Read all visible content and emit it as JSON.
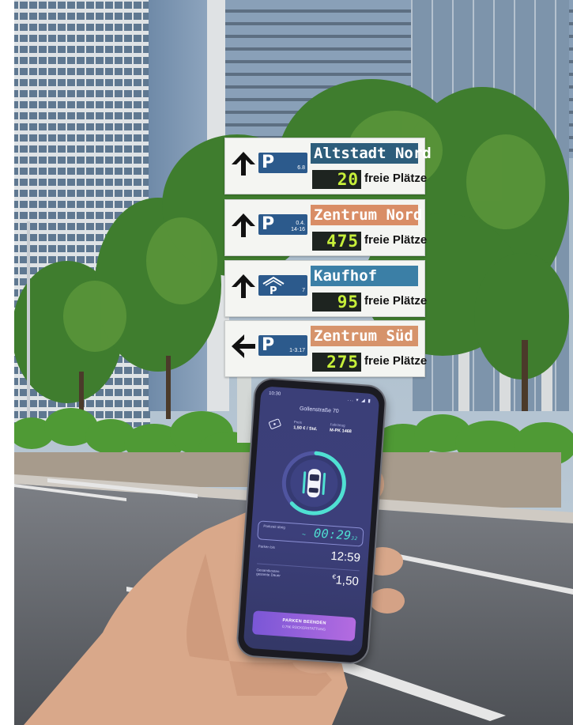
{
  "signs": [
    {
      "p_code": "6.8",
      "destination": "Altstadt Nord",
      "dest_color": "#2d5d7b",
      "count": "20",
      "count_label": "freie Plätze",
      "arrow": "arrow-up-icon"
    },
    {
      "p_code": "0.4.\n14-16",
      "destination": "Zentrum Nord",
      "dest_color": "#d98d66",
      "count": "475",
      "count_label": "freie Plätze",
      "arrow": "arrow-up-icon"
    },
    {
      "p_code": "7",
      "destination": "Kaufhof",
      "dest_color": "#3b7fa6",
      "count": "95",
      "count_label": "freie Plätze",
      "arrow": "arrow-up-icon"
    },
    {
      "p_code": "1-3.17",
      "destination": "Zentrum Süd",
      "dest_color": "#d6936b",
      "count": "275",
      "count_label": "freie Plätze",
      "arrow": "arrow-left-icon"
    }
  ],
  "sign_p_letter": "P",
  "phone": {
    "status_time": "10:30",
    "status_icons": "... ▾ ◢ ▮",
    "street": "Gollenstraße 70",
    "price_label": "Preis",
    "price_value": "1,50 € / Std.",
    "vehicle_label": "Fahrzeug",
    "vehicle_value": "M-PK 1468",
    "timer_label": "Parkzeit übrig",
    "timer_prefix": "~",
    "timer_value": "00:29",
    "timer_seconds": "32",
    "end_label": "Parken bis",
    "end_value": "12:59",
    "cost_label_1": "Gesamtkosten",
    "cost_label_2": "gesamte Dauer",
    "cost_currency": "€",
    "cost_value": "1,50",
    "button_label": "PARKEN BEENDEN",
    "button_sublabel": "0,75€ RÜCKERSTATTUNG",
    "ring_progress": 0.62,
    "accent_color": "#4fe0d2"
  }
}
